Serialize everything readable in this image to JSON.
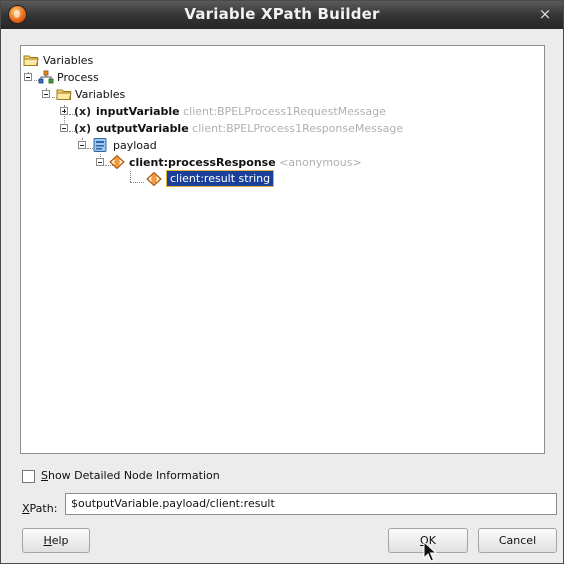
{
  "window": {
    "title": "Variable XPath Builder",
    "close_glyph": "×",
    "icon": "app-icon"
  },
  "tree": {
    "root": {
      "label": "Variables",
      "icon": "folder-open-icon"
    },
    "process": {
      "label": "Process",
      "icon": "process-icon",
      "expander": "-"
    },
    "variables": {
      "label": "Variables",
      "icon": "folder-open-icon",
      "expander": "-"
    },
    "input_variable": {
      "label": "inputVariable",
      "type": "client:BPELProcess1RequestMessage",
      "icon": "variable-icon",
      "expander": "+"
    },
    "output_variable": {
      "label": "outputVariable",
      "type": "client:BPELProcess1ResponseMessage",
      "icon": "variable-icon",
      "expander": "-"
    },
    "payload": {
      "label": "payload",
      "icon": "message-part-icon",
      "expander": "-"
    },
    "process_response": {
      "label": "client:processResponse",
      "type": "<anonymous>",
      "icon": "element-icon",
      "expander": "-"
    },
    "result": {
      "label": "client:result string",
      "icon": "element-icon",
      "selected": true
    }
  },
  "options": {
    "show_detailed": {
      "mnemonic": "S",
      "rest": "how Detailed Node Information",
      "checked": false
    }
  },
  "xpath": {
    "label_mnemonic": "X",
    "label_rest": "Path:",
    "value": "$outputVariable.payload/client:result"
  },
  "buttons": {
    "help": {
      "mnemonic": "H",
      "rest": "elp"
    },
    "ok": {
      "before": "",
      "mnemonic": "O",
      "rest": "K"
    },
    "cancel": {
      "label": "Cancel"
    }
  },
  "colors": {
    "selection": "#1a3f9a",
    "selection_border": "#e1b53a",
    "type_text": "#b0b0b0",
    "title_bar": "#333333"
  }
}
